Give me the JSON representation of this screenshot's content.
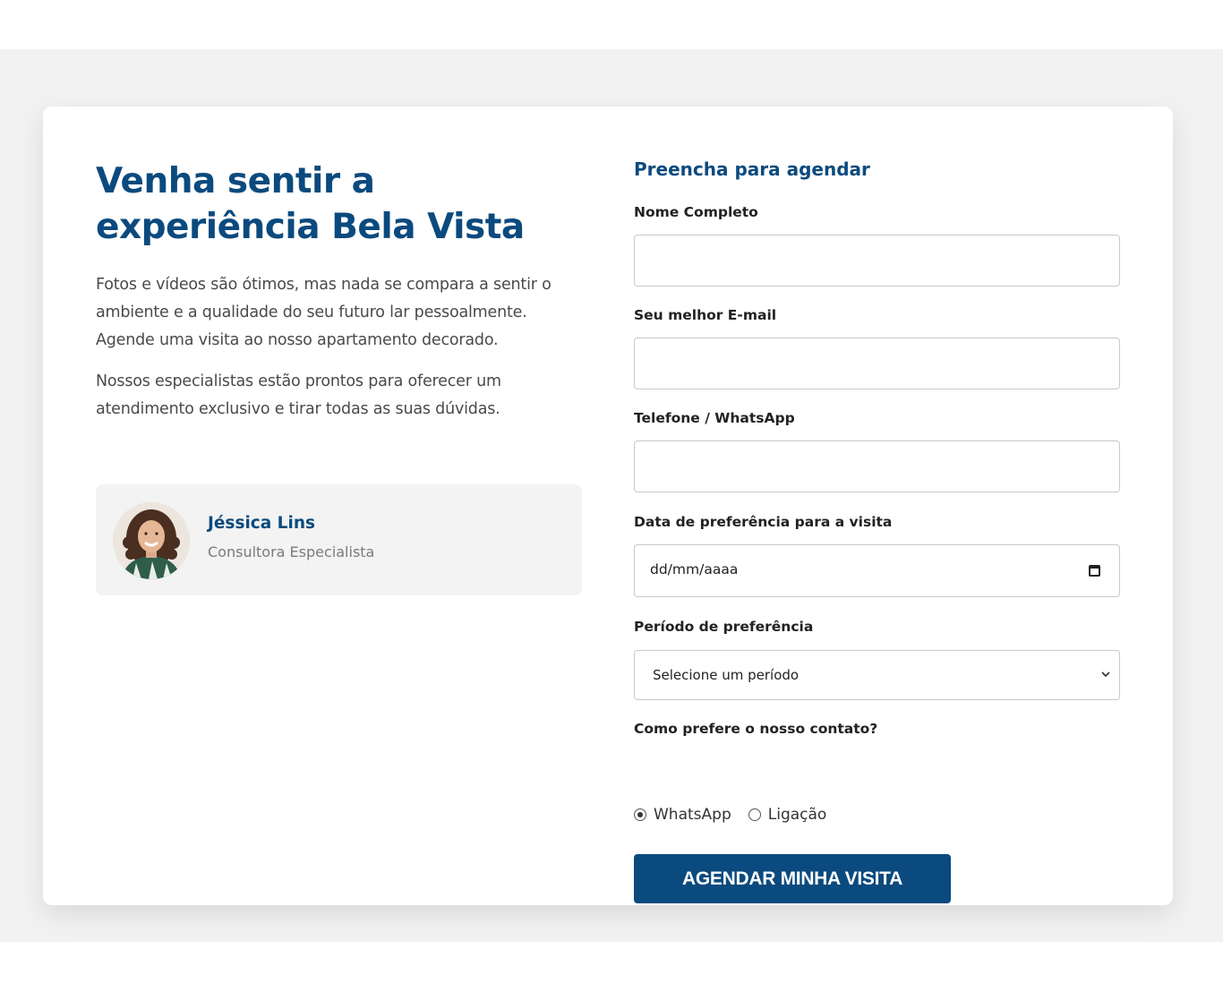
{
  "intro": {
    "headline_line1": "Venha sentir a",
    "headline_line2": "experiência Bela Vista",
    "paragraph1": "Fotos e vídeos são ótimos, mas nada se compara a sentir o ambiente e a qualidade do seu futuro lar pessoalmente. Agende uma visita ao nosso apartamento decorado.",
    "paragraph2": "Nossos especialistas estão prontos para oferecer um atendimento exclusivo e tirar todas as suas dúvidas."
  },
  "consultant": {
    "name": "Jéssica Lins",
    "role": "Consultora Especialista",
    "avatar_icon": "consultant-photo"
  },
  "form": {
    "title": "Preencha para agendar",
    "name_label": "Nome Completo",
    "name_value": "",
    "email_label": "Seu melhor E-mail",
    "email_value": "",
    "phone_label": "Telefone / WhatsApp",
    "phone_value": "",
    "date_label": "Data de preferência para a visita",
    "date_placeholder": "dd/mm/aaaa",
    "date_icon": "calendar-icon",
    "period_label": "Período de preferência",
    "period_selected": "Selecione um período",
    "period_icon": "chevron-down-icon",
    "contact_label": "Como prefere o nosso contato?",
    "contact_options": [
      {
        "label": "WhatsApp",
        "checked": true
      },
      {
        "label": "Ligação",
        "checked": false
      }
    ],
    "submit_label": "AGENDAR MINHA VISITA"
  },
  "colors": {
    "brand_blue": "#0b4a7e",
    "page_band": "#f2f2f2",
    "card_bg": "#ffffff",
    "consultant_bg": "#f3f3f3"
  }
}
